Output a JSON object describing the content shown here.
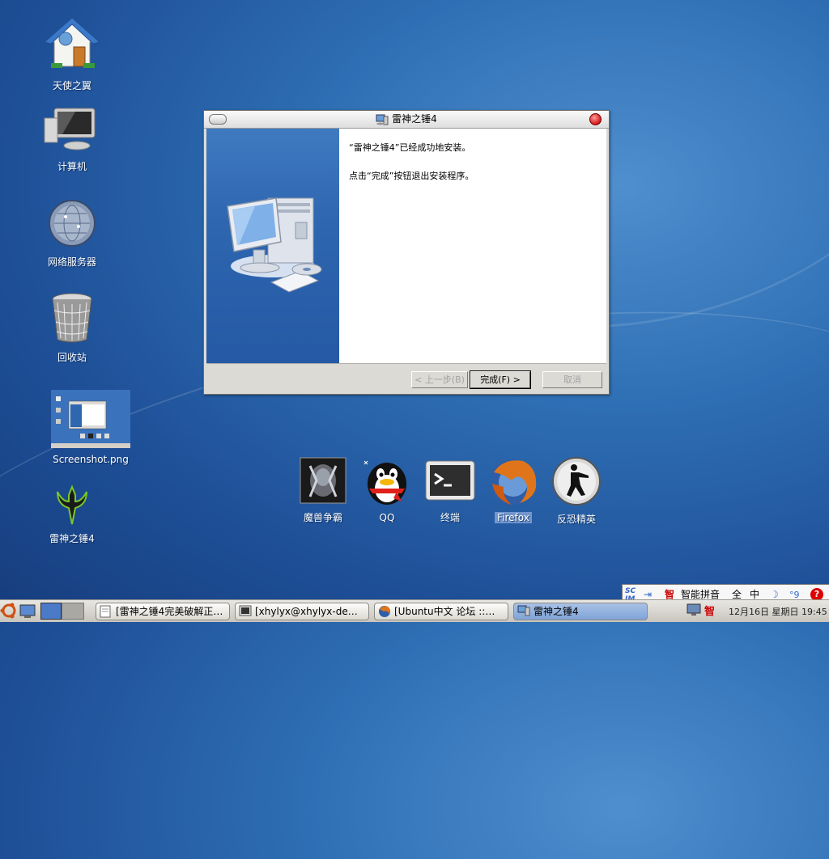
{
  "desktop": {
    "icons": [
      {
        "label": "天使之翼"
      },
      {
        "label": "计算机"
      },
      {
        "label": "网络服务器"
      },
      {
        "label": "回收站"
      },
      {
        "label": "Screenshot.png"
      },
      {
        "label": "雷神之锤4"
      }
    ]
  },
  "dialog": {
    "title": "雷神之锤4",
    "message_line1": "“雷神之锤4”已经成功地安装。",
    "message_line2": "点击“完成”按钮退出安装程序。",
    "back_button": "< 上一步(B)",
    "finish_button": "完成(F) >",
    "cancel_button": "取消"
  },
  "dock": {
    "items": [
      {
        "label": "魔兽争霸"
      },
      {
        "label": "QQ"
      },
      {
        "label": "终端"
      },
      {
        "label": "Firefox"
      },
      {
        "label": "反恐精英"
      }
    ]
  },
  "taskbar": {
    "tasks": [
      {
        "label": "[雷神之锤4完美破解正…"
      },
      {
        "label": "[xhylyx@xhylyx-de…"
      },
      {
        "label": "[Ubuntu中文 论坛 ::…"
      },
      {
        "label": "雷神之锤4"
      }
    ],
    "clock": "12月16日 星期日 19:45"
  },
  "ime": {
    "logo": "SC IM",
    "mode": "智能拼音",
    "full": "全",
    "lang": "中",
    "punct": "°9"
  },
  "colors": {
    "desktop_bg": "#2f6fb4",
    "dialog_panel": "#2e66b0",
    "taskbar_active": "#7fa4d8"
  }
}
